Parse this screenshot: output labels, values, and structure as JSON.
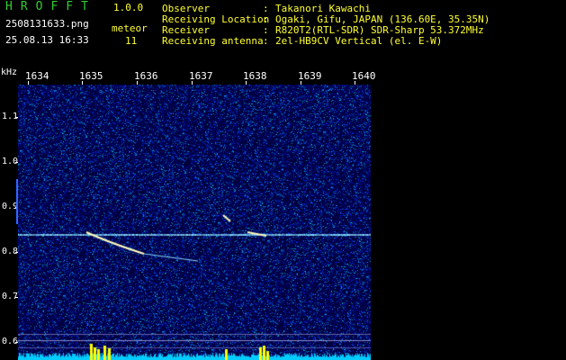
{
  "header": {
    "app_title": "HROFFT",
    "version": "1.0.0",
    "filename": "2508131633.png",
    "datetime": "25.08.13 16:33",
    "meteor_label": "meteor",
    "meteor_count": "11"
  },
  "info": [
    {
      "key": "Observer",
      "value": "Takanori Kawachi"
    },
    {
      "key": "Receiving Location",
      "value": "Ogaki, Gifu, JAPAN (136.60E, 35.35N)"
    },
    {
      "key": "Receiver",
      "value": "R820T2(RTL-SDR) SDR-Sharp 53.372MHz"
    },
    {
      "key": "Receiving antenna",
      "value": "2el-HB9CV Vertical (el. E-W)"
    }
  ],
  "spectrogram": {
    "y_unit": "kHz",
    "x_ticks": [
      "1634",
      "1635",
      "1636",
      "1637",
      "1638",
      "1639",
      "1640"
    ],
    "y_ticks": [
      "1.1",
      "1.0",
      "0.9",
      "0.8",
      "0.7",
      "0.6"
    ],
    "colors": {
      "background": "#06065a",
      "carrier": "#88ddff",
      "meteor": "#ffffc0",
      "baseline": "#00ccff",
      "peaks": "#ffff00"
    }
  }
}
